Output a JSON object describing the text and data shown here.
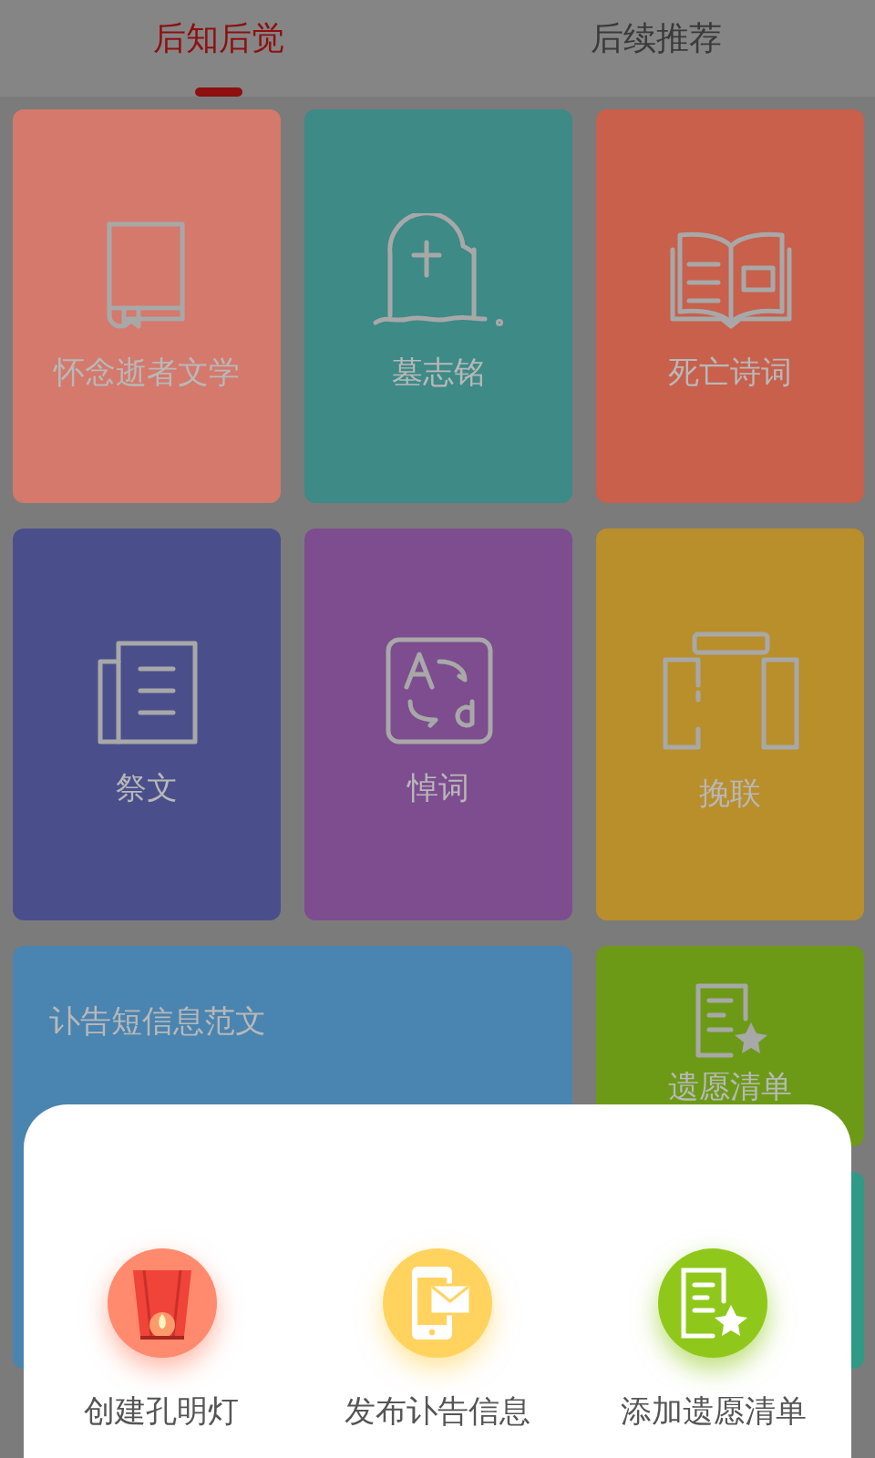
{
  "tabs": [
    {
      "label": "后知后觉",
      "selected": true
    },
    {
      "label": "后续推荐",
      "selected": false
    }
  ],
  "tiles": [
    {
      "label": "怀念逝者文学",
      "color": "#d5796c",
      "kind": "book"
    },
    {
      "label": "墓志铭",
      "color": "#3d8a87",
      "kind": "grave"
    },
    {
      "label": "死亡诗词",
      "color": "#c8604c",
      "kind": "openbook"
    },
    {
      "label": "祭文",
      "color": "#4a4f8c",
      "kind": "document"
    },
    {
      "label": "悼词",
      "color": "#7d4d8f",
      "kind": "translate"
    },
    {
      "label": "挽联",
      "color": "#b98f2c",
      "kind": "couplet"
    },
    {
      "label": "讣告短信息范文",
      "color": "#4a84b0",
      "kind": "wide"
    },
    {
      "label": "遗愿清单",
      "color": "#6c9a17",
      "kind": "wishlist"
    },
    {
      "color": "#2f9a85",
      "kind": "blank"
    }
  ],
  "actions": [
    {
      "label": "创建孔明灯",
      "color": "#ff8a6e",
      "kind": "lantern"
    },
    {
      "label": "发布讣告信息",
      "color": "#ffd35e",
      "kind": "phone"
    },
    {
      "label": "添加遗愿清单",
      "color": "#8fc81a",
      "kind": "wishlist"
    }
  ]
}
